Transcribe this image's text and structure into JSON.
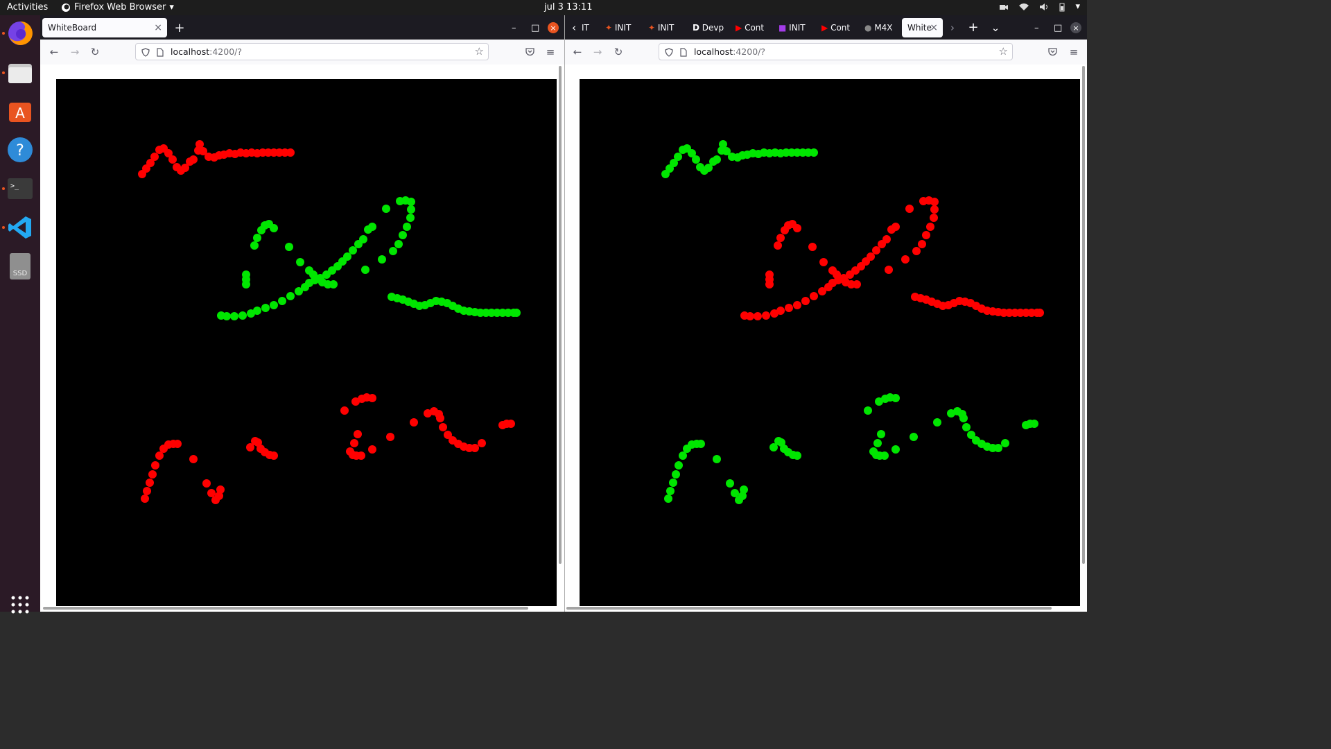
{
  "topbar": {
    "activities": "Activities",
    "app_menu": "Firefox Web Browser",
    "clock": "jul 3  13:11"
  },
  "dock": {
    "items": [
      "firefox-icon",
      "files-icon",
      "software-icon",
      "help-icon",
      "terminal-icon",
      "vscode-icon",
      "ssd-drive-icon"
    ],
    "ssd_label": "SSD"
  },
  "left_window": {
    "tab_title": "WhiteBoard",
    "url_host": "localhost",
    "url_path": ":4200/?",
    "stroke_colors": {
      "top": "#ff0000",
      "middle": "#00e600",
      "bottom": "#ff0000"
    }
  },
  "right_window": {
    "tabs": [
      {
        "label": "IT",
        "icon": "text"
      },
      {
        "label": "INIT",
        "icon": "init-icon"
      },
      {
        "label": "INIT",
        "icon": "init-icon"
      },
      {
        "label": "Devp",
        "icon": "dev-icon"
      },
      {
        "label": "Cont",
        "icon": "youtube-icon"
      },
      {
        "label": "INIT",
        "icon": "purple-icon"
      },
      {
        "label": "Cont",
        "icon": "youtube-icon"
      },
      {
        "label": "M4X",
        "icon": "github-icon"
      },
      {
        "label": "White",
        "icon": "active"
      }
    ],
    "url_host": "localhost",
    "url_path": ":4200/?",
    "stroke_colors": {
      "top": "#00e600",
      "middle": "#ff0000",
      "bottom": "#00e600"
    }
  }
}
